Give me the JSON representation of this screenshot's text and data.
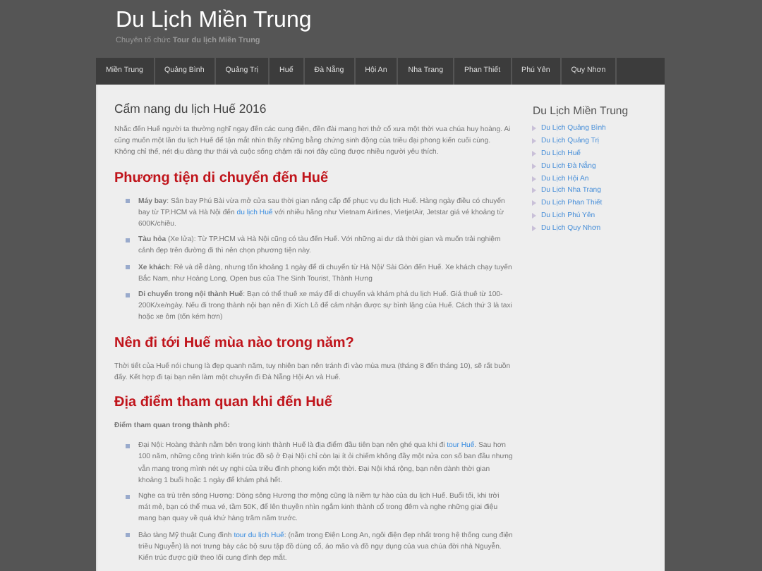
{
  "site": {
    "title": "Du Lịch Miền Trung",
    "tagline": "Chuyên tổ chức **Tour du lịch Miền Trung**"
  },
  "nav": [
    {
      "label": "Miền Trung"
    },
    {
      "label": "Quảng Bình"
    },
    {
      "label": "Quảng Trị"
    },
    {
      "label": "Huế"
    },
    {
      "label": "Đà Nẵng"
    },
    {
      "label": "Hội An"
    },
    {
      "label": "Nha Trang"
    },
    {
      "label": "Phan Thiết"
    },
    {
      "label": "Phú Yên"
    },
    {
      "label": "Quy Nhơn"
    }
  ],
  "article": {
    "title": "Cẩm nang du lịch Huế 2016",
    "blocks": [
      {
        "kind": "paragraph",
        "parts": [
          {
            "text": "Nhắc đến Huế người ta thường nghĩ ngay đến các cung điện, đền đài mang hơi thở cổ xưa một thời vua chúa huy hoàng. Ai cũng muốn một lần du lịch Huế để tận mắt nhìn thấy những bằng chứng sinh động của triều đại phong kiến cuối cùng. Không chỉ thế, nét dịu dàng thư thái và cuộc sống chậm rãi nơi đây cũng được nhiều người yêu thích."
          }
        ]
      },
      {
        "kind": "heading",
        "text": "Phương tiện di chuyển đến Huế"
      },
      {
        "kind": "list",
        "items": [
          {
            "parts": [
              {
                "text": "**Máy bay**: Sân bay Phú Bài vừa mở cửa sau thời gian nâng cấp để phục vụ du lịch Huế. Hàng ngày điều có chuyến bay từ TP.HCM và Hà Nội đến "
              },
              {
                "link": "du lịch Huế"
              },
              {
                "text": " với nhiều hãng như Vietnam Airlines, VietjetAir, Jetstar giá vé khoảng từ 600K/chiều."
              }
            ]
          },
          {
            "parts": [
              {
                "text": "**Tàu hỏa** (Xe lửa): Từ TP.HCM và Hà Nội cũng có tàu đến Huế. Với những ai dư dả thời gian và muốn trải nghiệm cảnh đẹp trên đường đi thì nên chọn phương tiện này."
              }
            ]
          },
          {
            "parts": [
              {
                "text": "**Xe khách**: Rẻ và dễ dàng, nhưng tốn khoảng 1 ngày để di chuyển từ Hà Nội/ Sài Gòn đến Huế. Xe khách chạy tuyến Bắc Nam, như Hoàng Long, Open bus của The Sinh Tourist, Thành Hưng"
              }
            ]
          },
          {
            "parts": [
              {
                "text": "**Di chuyển trong nội thành Huế**: Bạn có thể thuê xe máy để di chuyển và khám phá du lịch Huế. Giá thuê từ 100-200K/xe/ngày. Nếu đi trong thành nội bạn nên đi Xích Lô để cảm nhận được sự bình lặng của Huế. Cách thứ 3 là taxi hoặc xe ôm (tốn kém hơn)"
              }
            ]
          }
        ]
      },
      {
        "kind": "heading",
        "text": "Nên đi tới Huế mùa nào trong năm?"
      },
      {
        "kind": "paragraph",
        "parts": [
          {
            "text": "Thời tiết của Huế nói chung là đẹp quanh năm, tuy nhiên bạn nên tránh đi vào mùa mưa (tháng 8 đến tháng 10), sẽ rất buồn đấy. Kết hợp đi tại bạn nên làm một chuyến đi Đà Nẵng Hội An và Huế."
          }
        ]
      },
      {
        "kind": "heading",
        "text": "Địa điểm tham quan khi đến Huế"
      },
      {
        "kind": "paragraph",
        "parts": [
          {
            "text": "**Điểm tham quan trong thành phố:**"
          }
        ]
      },
      {
        "kind": "list",
        "items": [
          {
            "parts": [
              {
                "text": "Đại Nội: Hoàng thành nằm bên trong kinh thành Huế là địa điểm đầu tiên bạn nên ghé qua khi đi "
              },
              {
                "link": "tour Huế"
              },
              {
                "text": ". Sau hơn 100 năm, những công trình kiến trúc đồ sộ ở Đại Nội chỉ còn lại ít ỏi chiếm không đầy một nửa con số ban đầu nhưng vẫn mang trong mình nét uy nghi của triều đình phong kiến một thời. Đại Nội khá rộng, bạn nên dành thời gian khoảng 1 buổi hoặc 1 ngày để khám phá hết."
              }
            ]
          },
          {
            "parts": [
              {
                "text": "Nghe ca trù trên sông Hương: Dòng sông Hương thơ mộng cũng là niềm tự hào của du lịch Huế. Buổi tối, khi trời mát mẻ, bạn có thể mua vé, tầm 50K, để lên thuyền nhìn ngắm kinh thành cổ trong đêm và nghe những giai điệu mang bạn quay về quá khứ hàng trăm năm trước."
              }
            ]
          },
          {
            "parts": [
              {
                "text": "Bảo tàng Mỹ thuật Cung đình "
              },
              {
                "link": "tour du lịch Huế"
              },
              {
                "text": ": (nằm trong Điện Long An, ngôi điện đẹp nhất trong hệ thống cung điện triều Nguyễn) là nơi trưng bày các bộ sưu tập đồ dùng cổ, áo mão và đồ ngự dụng của vua chúa đời nhà Nguyễn. Kiến trúc được giữ theo lối cung đình đẹp mắt."
              }
            ]
          }
        ]
      }
    ]
  },
  "sidebar": {
    "title": "Du Lịch Miền Trung",
    "links": [
      "Du Lịch Quảng Bình",
      "Du Lịch Quảng Trị",
      "Du Lịch Huế",
      "Du Lịch Đà Nẵng",
      "Du Lịch Hội An",
      "Du Lịch Nha Trang",
      "Du Lịch Phan Thiết",
      "Du Lịch Phú Yên",
      "Du Lịch Quy Nhơn"
    ]
  }
}
